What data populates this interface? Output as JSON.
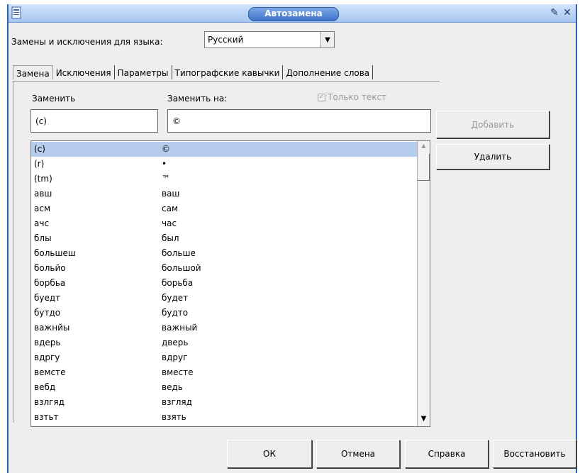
{
  "window": {
    "title": "Автозамена"
  },
  "language_row": {
    "label": "Замены и исключения для языка:",
    "selected": "Русский"
  },
  "tabs": [
    {
      "label": "Замена",
      "active": true
    },
    {
      "label": "Исключения",
      "active": false
    },
    {
      "label": "Параметры",
      "active": false
    },
    {
      "label": "Типографские кавычки",
      "active": false
    },
    {
      "label": "Дополнение слова",
      "active": false
    }
  ],
  "replace_tab": {
    "replace_label": "Заменить",
    "with_label": "Заменить на:",
    "text_only_label": "Только текст",
    "replace_value": "(c)",
    "with_value": "©"
  },
  "entries": [
    {
      "from": "(c)",
      "to": "©"
    },
    {
      "from": "(r)",
      "to": "•"
    },
    {
      "from": "(tm)",
      "to": "™"
    },
    {
      "from": "авш",
      "to": "ваш"
    },
    {
      "from": "асм",
      "to": "сам"
    },
    {
      "from": "ачс",
      "to": "час"
    },
    {
      "from": "блы",
      "to": "был"
    },
    {
      "from": "большеш",
      "to": "больше"
    },
    {
      "from": "больйо",
      "to": "большой"
    },
    {
      "from": "борбьа",
      "to": "борьба"
    },
    {
      "from": "буедт",
      "to": "будет"
    },
    {
      "from": "бутдо",
      "to": "будто"
    },
    {
      "from": "важнйы",
      "to": "важный"
    },
    {
      "from": "вдерь",
      "to": "дверь"
    },
    {
      "from": "вдргу",
      "to": "вдруг"
    },
    {
      "from": "вемсте",
      "to": "вместе"
    },
    {
      "from": "вебд",
      "to": "ведь"
    },
    {
      "from": "взлгяд",
      "to": "взгляд"
    },
    {
      "from": "взтьт",
      "to": "взять"
    }
  ],
  "side_buttons": {
    "add": "Добавить",
    "delete": "Удалить"
  },
  "footer_buttons": {
    "ok": "ОК",
    "cancel": "Отмена",
    "help": "Справка",
    "restore": "Восстановить"
  }
}
